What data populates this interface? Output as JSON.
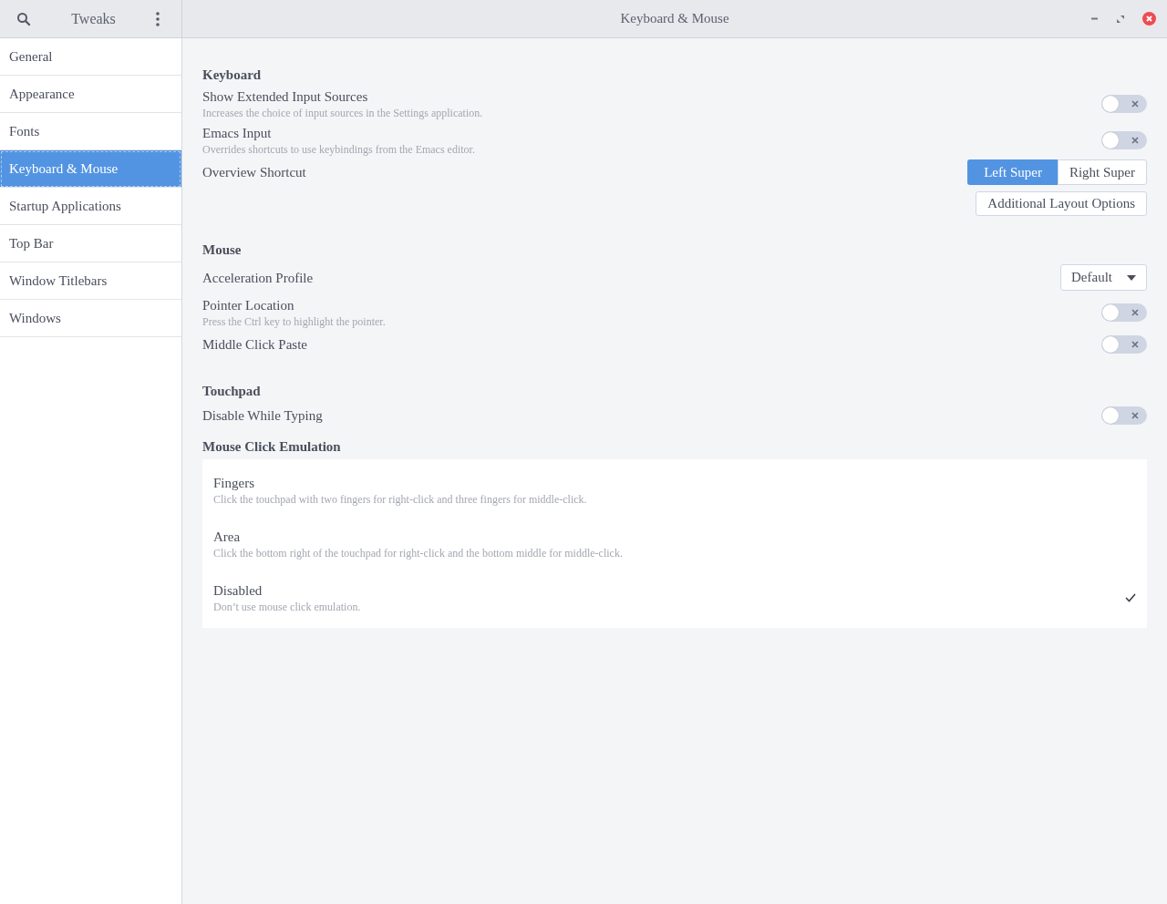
{
  "sidebar_header": {
    "title": "Tweaks"
  },
  "window": {
    "title": "Keyboard & Mouse"
  },
  "sidebar": {
    "items": [
      {
        "label": "General",
        "selected": false
      },
      {
        "label": "Appearance",
        "selected": false
      },
      {
        "label": "Fonts",
        "selected": false
      },
      {
        "label": "Keyboard & Mouse",
        "selected": true
      },
      {
        "label": "Startup Applications",
        "selected": false
      },
      {
        "label": "Top Bar",
        "selected": false
      },
      {
        "label": "Window Titlebars",
        "selected": false
      },
      {
        "label": "Windows",
        "selected": false
      }
    ]
  },
  "sections": [
    {
      "kind": "settings",
      "title": "Keyboard",
      "rows": [
        {
          "kind": "switch",
          "label": "Show Extended Input Sources",
          "description": "Increases the choice of input sources in the Settings application.",
          "on": false
        },
        {
          "kind": "switch",
          "label": "Emacs Input",
          "description": "Overrides shortcuts to use keybindings from the Emacs editor.",
          "on": false
        },
        {
          "kind": "segmented",
          "label": "Overview Shortcut",
          "options": [
            {
              "label": "Left Super",
              "selected": true
            },
            {
              "label": "Right Super",
              "selected": false
            }
          ]
        },
        {
          "kind": "button",
          "label": "Additional Layout Options"
        }
      ]
    },
    {
      "kind": "settings",
      "title": "Mouse",
      "rows": [
        {
          "kind": "dropdown",
          "label": "Acceleration Profile",
          "value": "Default"
        },
        {
          "kind": "switch",
          "label": "Pointer Location",
          "description": "Press the Ctrl key to highlight the pointer.",
          "on": false
        },
        {
          "kind": "switch",
          "label": "Middle Click Paste",
          "on": false
        }
      ]
    },
    {
      "kind": "settings",
      "title": "Touchpad",
      "rows": [
        {
          "kind": "switch",
          "label": "Disable While Typing",
          "on": false
        }
      ]
    },
    {
      "kind": "choices",
      "title": "Mouse Click Emulation",
      "rows": [
        {
          "label": "Fingers",
          "description": "Click the touchpad with two fingers for right-click and three fingers for middle-click.",
          "selected": false
        },
        {
          "label": "Area",
          "description": "Click the bottom right of the touchpad for right-click and the bottom middle for middle-click.",
          "selected": false
        },
        {
          "label": "Disabled",
          "description": "Don’t use mouse click emulation.",
          "selected": true
        }
      ]
    }
  ]
}
